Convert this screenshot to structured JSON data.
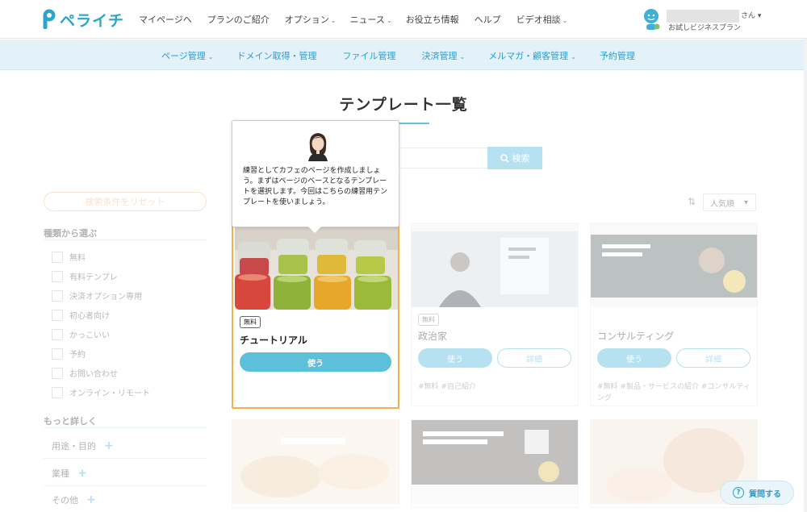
{
  "brand": {
    "name": "ペライチ",
    "color": "#2aa6c8"
  },
  "topnav": [
    {
      "label": "マイページへ",
      "caret": ""
    },
    {
      "label": "プランのご紹介",
      "caret": ""
    },
    {
      "label": "オプション",
      "caret": "⌄"
    },
    {
      "label": "ニュース",
      "caret": "⌄"
    },
    {
      "label": "お役立ち情報",
      "caret": ""
    },
    {
      "label": "ヘルプ",
      "caret": ""
    },
    {
      "label": "ビデオ相談",
      "caret": "⌄"
    }
  ],
  "user": {
    "suffix": "さん ▾",
    "plan": "お試しビジネスプラン"
  },
  "subnav": [
    {
      "label": "ページ管理",
      "caret": "⌄"
    },
    {
      "label": "ドメイン取得・管理",
      "caret": ""
    },
    {
      "label": "ファイル管理",
      "caret": ""
    },
    {
      "label": "決済管理",
      "caret": "⌄"
    },
    {
      "label": "メルマガ・顧客管理",
      "caret": "⌄"
    },
    {
      "label": "予約管理",
      "caret": ""
    }
  ],
  "page_title": "テンプレート一覧",
  "search": {
    "button": "検索"
  },
  "sidebar": {
    "reset": "検索条件をリセット",
    "type_heading": "種類から選ぶ",
    "types": [
      "無料",
      "有料テンプレ",
      "決済オプション専用",
      "初心者向け",
      "かっこいい",
      "予約",
      "お問い合わせ",
      "オンライン・リモート"
    ],
    "more_heading": "もっと詳しく",
    "more_items": [
      "用途・目的",
      "業種",
      "その他"
    ]
  },
  "sort": {
    "selected": "人気順",
    "caret": "▾"
  },
  "tutorial_card": {
    "badge": "無料",
    "name": "チュートリアル",
    "use": "使う"
  },
  "cards": [
    {
      "badge": "無料",
      "name": "政治家",
      "use": "使う",
      "detail": "詳細",
      "tags": "#無料 #自己紹介"
    },
    {
      "badge": "",
      "name": "コンサルティング",
      "use": "使う",
      "detail": "詳細",
      "tags": "#無料 #製品・サービスの紹介 #コンサルティング"
    }
  ],
  "tooltip": {
    "text": "練習としてカフェのページを作成しましょう。まずはページのベースとなるテンプレートを選択します。今回はこちらの練習用テンプレートを使いましょう。"
  },
  "help": {
    "label": "質問する"
  }
}
